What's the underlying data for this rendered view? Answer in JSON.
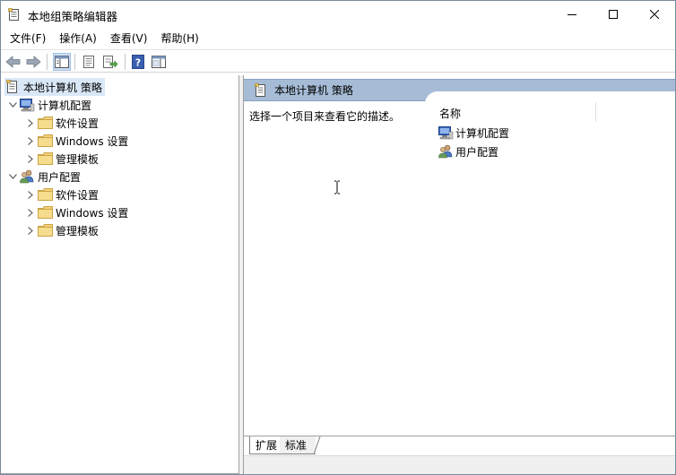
{
  "window": {
    "title": "本地组策略编辑器"
  },
  "menu": {
    "items": [
      "文件(F)",
      "操作(A)",
      "查看(V)",
      "帮助(H)"
    ]
  },
  "toolbar": {
    "buttons": [
      "back-icon",
      "forward-icon",
      "show-hide-tree-icon",
      "properties-icon",
      "export-list-icon",
      "help-icon",
      "action-pane-icon"
    ]
  },
  "tree": {
    "root": "本地计算机 策略",
    "computer_config": "计算机配置",
    "user_config": "用户配置",
    "software_settings": "软件设置",
    "windows_settings": "Windows 设置",
    "admin_templates": "管理模板"
  },
  "right": {
    "header": "本地计算机 策略",
    "description": "选择一个项目来查看它的描述。",
    "column_name": "名称",
    "items": [
      "计算机配置",
      "用户配置"
    ]
  },
  "tabs": {
    "extended": "扩展",
    "standard": "标准"
  },
  "colors": {
    "header_bg": "#a6bcd6",
    "selection_bg": "#d9e7f7",
    "folder": "#e8c25a"
  }
}
